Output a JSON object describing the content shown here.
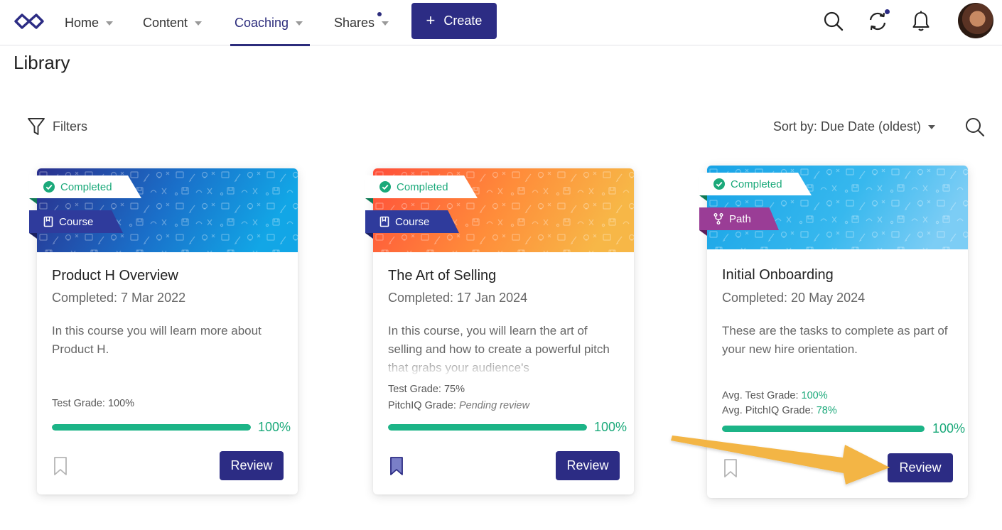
{
  "nav": {
    "items": [
      {
        "label": "Home"
      },
      {
        "label": "Content"
      },
      {
        "label": "Coaching"
      },
      {
        "label": "Shares"
      }
    ],
    "create_label": "Create"
  },
  "page": {
    "title": "Library",
    "filters_label": "Filters",
    "sort_label": "Sort by: Due Date (oldest)"
  },
  "colors": {
    "primary": "#2c2c84",
    "success": "#1ba97a",
    "course_ribbon": "#2f3b9c",
    "path_ribbon": "#9a3d96",
    "annotation_arrow": "#f3b544"
  },
  "cards": [
    {
      "status": "Completed",
      "type": "Course",
      "type_icon": "book-icon",
      "title": "Product H Overview",
      "date": "Completed: 7 Mar 2022",
      "description": "In this course you will learn more about Product H.",
      "grade1_label": "Test Grade: 100%",
      "progress_percent": 100,
      "progress_label": "100%",
      "bookmarked": false,
      "review_label": "Review"
    },
    {
      "status": "Completed",
      "type": "Course",
      "type_icon": "book-icon",
      "title": "The Art of Selling",
      "date": "Completed: 17 Jan 2024",
      "description": "In this course, you will learn the art of selling and how to create a powerful pitch that grabs your audience's",
      "grade1_label": "Test Grade: 75%",
      "grade2_prefix": "PitchIQ Grade: ",
      "grade2_value": "Pending review",
      "progress_percent": 100,
      "progress_label": "100%",
      "bookmarked": true,
      "review_label": "Review"
    },
    {
      "status": "Completed",
      "type": "Path",
      "type_icon": "path-fork-icon",
      "title": "Initial Onboarding",
      "date": "Completed: 20 May 2024",
      "description": "These are the tasks to complete as part of your new hire orientation.",
      "grade1_prefix": "Avg. Test Grade: ",
      "grade1_value": "100%",
      "grade2_prefix": "Avg. PitchIQ Grade: ",
      "grade2_value": "78%",
      "progress_percent": 100,
      "progress_label": "100%",
      "bookmarked": false,
      "review_label": "Review"
    }
  ]
}
